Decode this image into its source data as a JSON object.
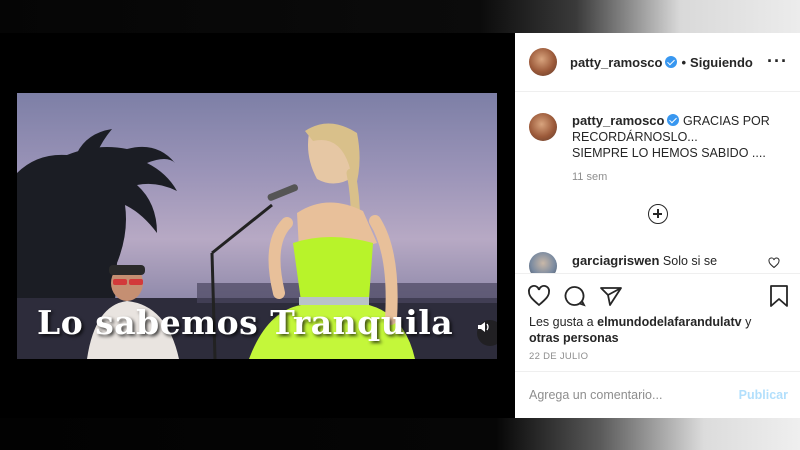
{
  "video": {
    "caption": "Lo sabemos Tranquila",
    "volume_icon": "speaker-icon"
  },
  "post": {
    "author": "patty_ramosco",
    "follow_state": "Siguiendo",
    "dot": "•",
    "more_icon": "···",
    "caption_lines": [
      "GRACIAS POR",
      "RECORDÁRNOSLO...",
      "SIEMPRE LO HEMOS SABIDO ...."
    ],
    "time": "11 sem",
    "load_more_icon": "plus-circle-icon"
  },
  "comment": {
    "user": "garciagriswen",
    "text": "Solo si se"
  },
  "actions": {
    "likes_prefix": "Les gusta a",
    "likes_user": "elmundodelafarandulatv",
    "likes_mid": "y",
    "likes_suffix": "otras personas",
    "date": "22 DE JULIO"
  },
  "composer": {
    "placeholder": "Agrega un comentario...",
    "publish_label": "Publicar"
  },
  "colors": {
    "verified": "#3897f0",
    "publish_disabled": "#b2dffc",
    "dress": "#b8f32a"
  }
}
